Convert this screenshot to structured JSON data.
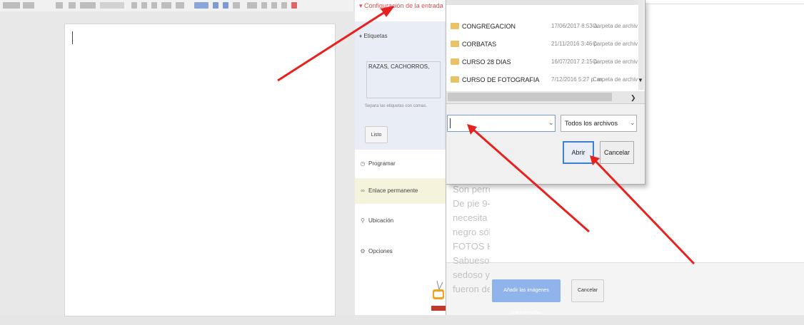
{
  "sidebar": {
    "config_link": "Configuración de la entrada",
    "labels_heading": "Etiquetas",
    "labels_value": "RAZAS, CACHORROS,",
    "labels_hint": "Separa las etiquetas con comas.",
    "done_label": "Listo",
    "items": [
      {
        "label": "Programar",
        "icon": "clock-icon"
      },
      {
        "label": "Enlace permanente",
        "icon": "link-icon"
      },
      {
        "label": "Ubicación",
        "icon": "location-pin-icon"
      },
      {
        "label": "Opciones",
        "icon": "gear-icon"
      }
    ]
  },
  "file_dialog": {
    "files": [
      {
        "name": "CONGREGACION",
        "date": "17/06/2017 8:53 a.",
        "type": "Carpeta de archiv"
      },
      {
        "name": "CORBATAS",
        "date": "21/11/2016 3:46 p.",
        "type": "Carpeta de archiv"
      },
      {
        "name": "CURSO 28 DIAS",
        "date": "16/07/2017 2:15 p.",
        "type": "Carpeta de archiv"
      },
      {
        "name": "CURSO DE FOTOGRAFIA",
        "date": "7/12/2016 5:27 p. m.",
        "type": "Carpeta de archiv"
      }
    ],
    "filename_value": "",
    "filetype_value": "Todos los archivos",
    "open_label": "Abrir",
    "cancel_label": "Cancelar"
  },
  "background_page": {
    "text_lines": [
      "Son perro",
      "De pie 9-",
      "necesita s",
      "negro sól",
      "FOTOS HA",
      "Sabueso a",
      "sedoso y",
      "fueron de"
    ],
    "add_selected_label": "Añadir las imágenes seleccionadas",
    "cancel_label": "Cancelar"
  },
  "colors": {
    "accent_red": "#d9534f",
    "arrow_red": "#e8211e",
    "primary_blue": "#8fb4ec",
    "focus_blue": "#3c7fd6"
  }
}
